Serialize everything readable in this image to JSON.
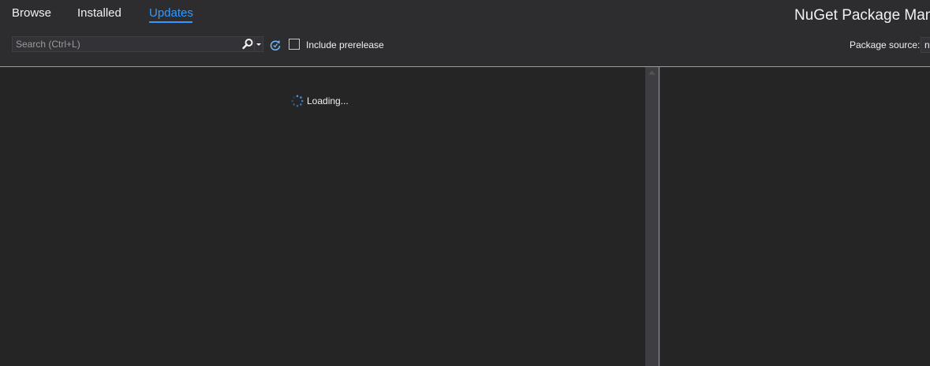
{
  "tabs": [
    {
      "label": "Browse",
      "active": false
    },
    {
      "label": "Installed",
      "active": false
    },
    {
      "label": "Updates",
      "active": true
    }
  ],
  "title": "NuGet Package Man",
  "search": {
    "placeholder": "Search (Ctrl+L)",
    "value": ""
  },
  "include_prerelease": {
    "label": "Include prerelease",
    "checked": false
  },
  "package_source": {
    "label": "Package source:",
    "value": "n"
  },
  "list": {
    "loading_text": "Loading..."
  },
  "icons": {
    "search": "search-icon",
    "dropdown": "chevron-down-icon",
    "refresh": "refresh-icon",
    "spinner": "loading-spinner-icon",
    "scroll_up": "scroll-up-arrow-icon"
  },
  "colors": {
    "background": "#2d2d30",
    "pane": "#252526",
    "accent": "#3399ff",
    "text": "#f1f1f1",
    "refresh_icon": "#6fb3f2"
  }
}
